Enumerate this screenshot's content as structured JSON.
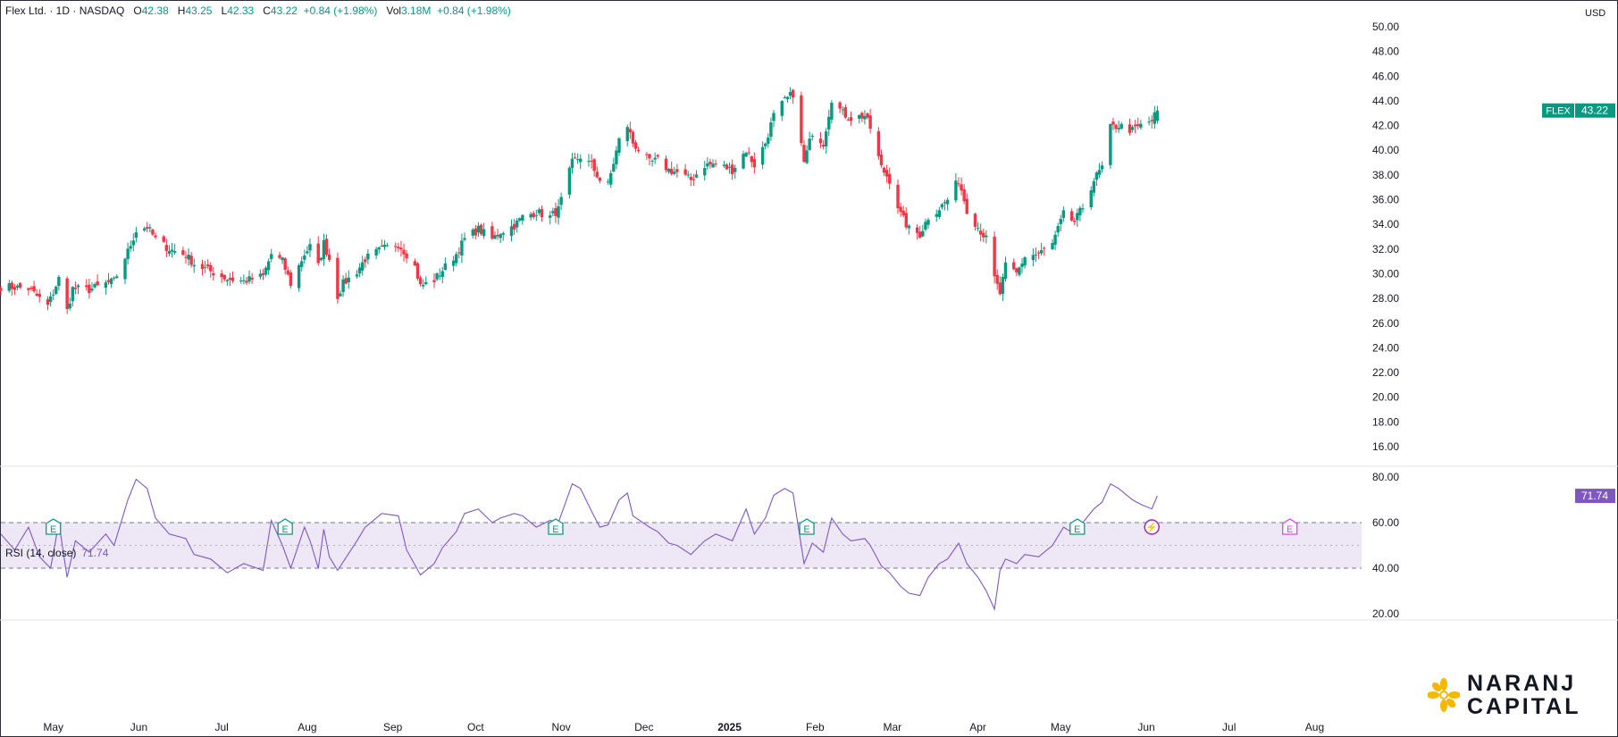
{
  "header": {
    "symbol_title": "Flex Ltd. · 1D · NASDAQ",
    "open_label": "O",
    "open": "42.38",
    "high_label": "H",
    "high": "43.25",
    "low_label": "L",
    "low": "42.33",
    "close_label": "C",
    "close": "43.22",
    "change": "+0.84 (+1.98%)",
    "vol_label": "Vol",
    "vol": "3.18M",
    "vol_change": "+0.84 (+1.98%)"
  },
  "currency": "USD",
  "price_tag": {
    "ticker": "FLEX",
    "value": "43.22"
  },
  "rsi": {
    "label": "RSI (14, close)",
    "value": "71.74",
    "tag": "71.74"
  },
  "logo": {
    "line1": "NARANJ",
    "line2": "CAPITAL"
  },
  "colors": {
    "up": "#089981",
    "down": "#f23645",
    "rsi": "#7e57c2",
    "band": "#ede7f6",
    "earnings": "#089981",
    "dividend": "#9c27b0",
    "upcoming": "#e040fb"
  },
  "events": [
    {
      "type": "earnings",
      "glyph": "E",
      "date": "2024-05-01"
    },
    {
      "type": "earnings",
      "glyph": "E",
      "date": "2024-07-24"
    },
    {
      "type": "earnings",
      "glyph": "E",
      "date": "2024-10-30"
    },
    {
      "type": "earnings",
      "glyph": "E",
      "date": "2025-01-29"
    },
    {
      "type": "earnings",
      "glyph": "E",
      "date": "2025-05-07"
    },
    {
      "type": "split",
      "glyph": "⚡",
      "date": "2025-06-03"
    },
    {
      "type": "earnings-upcoming",
      "glyph": "E",
      "date": "2025-07-23"
    }
  ],
  "chart_data": [
    {
      "type": "candlestick",
      "title": "Flex Ltd. · 1D · NASDAQ",
      "x_axis": {
        "type": "date",
        "range": [
          "2024-04-12",
          "2025-08-18"
        ],
        "ticks": [
          {
            "label": "May",
            "date": "2024-05-01",
            "bold": false
          },
          {
            "label": "Jun",
            "date": "2024-06-01",
            "bold": false
          },
          {
            "label": "Jul",
            "date": "2024-07-01",
            "bold": false
          },
          {
            "label": "Aug",
            "date": "2024-08-01",
            "bold": false
          },
          {
            "label": "Sep",
            "date": "2024-09-01",
            "bold": false
          },
          {
            "label": "Oct",
            "date": "2024-10-01",
            "bold": false
          },
          {
            "label": "Nov",
            "date": "2024-11-01",
            "bold": false
          },
          {
            "label": "Dec",
            "date": "2024-12-01",
            "bold": false
          },
          {
            "label": "2025",
            "date": "2025-01-01",
            "bold": true
          },
          {
            "label": "Feb",
            "date": "2025-02-01",
            "bold": false
          },
          {
            "label": "Mar",
            "date": "2025-03-01",
            "bold": false
          },
          {
            "label": "Apr",
            "date": "2025-04-01",
            "bold": false
          },
          {
            "label": "May",
            "date": "2025-05-01",
            "bold": false
          },
          {
            "label": "Jun",
            "date": "2025-06-01",
            "bold": false
          },
          {
            "label": "Jul",
            "date": "2025-07-01",
            "bold": false
          },
          {
            "label": "Aug",
            "date": "2025-08-01",
            "bold": false
          }
        ]
      },
      "y_axis": {
        "range": [
          14.6,
          51.6
        ],
        "ticks": [
          "16.00",
          "18.00",
          "20.00",
          "22.00",
          "24.00",
          "26.00",
          "28.00",
          "30.00",
          "32.00",
          "34.00",
          "36.00",
          "38.00",
          "40.00",
          "42.00",
          "44.00",
          "46.00",
          "48.00",
          "50.00"
        ]
      },
      "close_series": [
        [
          "2024-04-12",
          29.0
        ],
        [
          "2024-04-22",
          28.8
        ],
        [
          "2024-04-29",
          27.4
        ],
        [
          "2024-05-03",
          29.6
        ],
        [
          "2024-05-06",
          27.0
        ],
        [
          "2024-05-08",
          28.8
        ],
        [
          "2024-05-14",
          28.7
        ],
        [
          "2024-05-20",
          29.2
        ],
        [
          "2024-05-23",
          29.4
        ],
        [
          "2024-05-28",
          31.8
        ],
        [
          "2024-05-31",
          33.5
        ],
        [
          "2024-06-04",
          33.8
        ],
        [
          "2024-06-07",
          32.8
        ],
        [
          "2024-06-12",
          32.0
        ],
        [
          "2024-06-18",
          31.5
        ],
        [
          "2024-06-21",
          30.8
        ],
        [
          "2024-06-27",
          30.2
        ],
        [
          "2024-07-03",
          29.6
        ],
        [
          "2024-07-09",
          29.4
        ],
        [
          "2024-07-16",
          29.8
        ],
        [
          "2024-07-19",
          31.6
        ],
        [
          "2024-07-23",
          31.0
        ],
        [
          "2024-07-26",
          29.2
        ],
        [
          "2024-07-31",
          31.6
        ],
        [
          "2024-08-02",
          32.2
        ],
        [
          "2024-08-05",
          30.6
        ],
        [
          "2024-08-07",
          32.5
        ],
        [
          "2024-08-09",
          31.2
        ],
        [
          "2024-08-12",
          28.2
        ],
        [
          "2024-08-14",
          29.2
        ],
        [
          "2024-08-19",
          30.2
        ],
        [
          "2024-08-22",
          31.2
        ],
        [
          "2024-08-28",
          32.0
        ],
        [
          "2024-09-03",
          32.4
        ],
        [
          "2024-09-06",
          31.6
        ],
        [
          "2024-09-09",
          30.6
        ],
        [
          "2024-09-11",
          29.0
        ],
        [
          "2024-09-16",
          29.5
        ],
        [
          "2024-09-19",
          30.3
        ],
        [
          "2024-09-24",
          31.6
        ],
        [
          "2024-09-27",
          32.8
        ],
        [
          "2024-10-02",
          33.6
        ],
        [
          "2024-10-07",
          32.8
        ],
        [
          "2024-10-10",
          33.4
        ],
        [
          "2024-10-15",
          33.9
        ],
        [
          "2024-10-18",
          34.6
        ],
        [
          "2024-10-23",
          35.0
        ],
        [
          "2024-10-28",
          34.6
        ],
        [
          "2024-10-31",
          35.2
        ],
        [
          "2024-11-05",
          39.0
        ],
        [
          "2024-11-08",
          39.5
        ],
        [
          "2024-11-12",
          38.8
        ],
        [
          "2024-11-15",
          37.6
        ],
        [
          "2024-11-18",
          37.2
        ],
        [
          "2024-11-22",
          40.8
        ],
        [
          "2024-11-25",
          42.0
        ],
        [
          "2024-11-27",
          40.6
        ],
        [
          "2024-12-03",
          39.0
        ],
        [
          "2024-12-06",
          39.2
        ],
        [
          "2024-12-10",
          38.4
        ],
        [
          "2024-12-13",
          38.2
        ],
        [
          "2024-12-18",
          37.6
        ],
        [
          "2024-12-23",
          38.8
        ],
        [
          "2024-12-27",
          38.9
        ],
        [
          "2025-01-02",
          38.4
        ],
        [
          "2025-01-07",
          40.0
        ],
        [
          "2025-01-10",
          38.8
        ],
        [
          "2025-01-14",
          40.6
        ],
        [
          "2025-01-17",
          42.8
        ],
        [
          "2025-01-21",
          44.0
        ],
        [
          "2025-01-24",
          44.6
        ],
        [
          "2025-01-28",
          39.0
        ],
        [
          "2025-01-31",
          41.5
        ],
        [
          "2025-02-04",
          40.6
        ],
        [
          "2025-02-07",
          44.2
        ],
        [
          "2025-02-11",
          43.0
        ],
        [
          "2025-02-14",
          42.6
        ],
        [
          "2025-02-19",
          42.8
        ],
        [
          "2025-02-21",
          41.8
        ],
        [
          "2025-02-25",
          38.6
        ],
        [
          "2025-02-28",
          37.6
        ],
        [
          "2025-03-04",
          34.8
        ],
        [
          "2025-03-07",
          33.6
        ],
        [
          "2025-03-11",
          33.2
        ],
        [
          "2025-03-14",
          34.6
        ],
        [
          "2025-03-18",
          35.3
        ],
        [
          "2025-03-21",
          36.0
        ],
        [
          "2025-03-25",
          37.6
        ],
        [
          "2025-03-28",
          35.2
        ],
        [
          "2025-04-01",
          33.8
        ],
        [
          "2025-04-04",
          32.8
        ],
        [
          "2025-04-07",
          29.6
        ],
        [
          "2025-04-09",
          28.4
        ],
        [
          "2025-04-11",
          30.6
        ],
        [
          "2025-04-15",
          30.0
        ],
        [
          "2025-04-18",
          31.4
        ],
        [
          "2025-04-23",
          31.6
        ],
        [
          "2025-04-28",
          32.4
        ],
        [
          "2025-05-02",
          34.8
        ],
        [
          "2025-05-06",
          34.2
        ],
        [
          "2025-05-09",
          35.4
        ],
        [
          "2025-05-13",
          37.6
        ],
        [
          "2025-05-16",
          38.6
        ],
        [
          "2025-05-19",
          41.8
        ],
        [
          "2025-05-22",
          42.0
        ],
        [
          "2025-05-27",
          41.6
        ],
        [
          "2025-05-30",
          42.0
        ],
        [
          "2025-06-03",
          42.4
        ],
        [
          "2025-06-05",
          43.22
        ]
      ]
    },
    {
      "type": "line",
      "title": "RSI (14, close)",
      "y_axis": {
        "range": [
          16.5,
          83.5
        ],
        "ticks": [
          "20.00",
          "40.00",
          "60.00",
          "80.00"
        ],
        "band": [
          40,
          60
        ],
        "midline": 50
      },
      "series": [
        [
          "2024-04-12",
          55
        ],
        [
          "2024-04-17",
          48
        ],
        [
          "2024-04-22",
          58
        ],
        [
          "2024-04-26",
          45
        ],
        [
          "2024-04-30",
          40
        ],
        [
          "2024-05-03",
          60
        ],
        [
          "2024-05-06",
          36
        ],
        [
          "2024-05-09",
          52
        ],
        [
          "2024-05-14",
          47
        ],
        [
          "2024-05-20",
          55
        ],
        [
          "2024-05-23",
          50
        ],
        [
          "2024-05-28",
          70
        ],
        [
          "2024-05-31",
          79
        ],
        [
          "2024-06-04",
          75
        ],
        [
          "2024-06-07",
          62
        ],
        [
          "2024-06-12",
          55
        ],
        [
          "2024-06-18",
          53
        ],
        [
          "2024-06-21",
          46
        ],
        [
          "2024-06-27",
          44
        ],
        [
          "2024-07-03",
          38
        ],
        [
          "2024-07-09",
          42
        ],
        [
          "2024-07-16",
          39
        ],
        [
          "2024-07-19",
          61
        ],
        [
          "2024-07-23",
          50
        ],
        [
          "2024-07-26",
          40
        ],
        [
          "2024-07-31",
          58
        ],
        [
          "2024-08-02",
          52
        ],
        [
          "2024-08-05",
          40
        ],
        [
          "2024-08-07",
          57
        ],
        [
          "2024-08-09",
          45
        ],
        [
          "2024-08-12",
          39
        ],
        [
          "2024-08-19",
          52
        ],
        [
          "2024-08-22",
          58
        ],
        [
          "2024-08-28",
          64
        ],
        [
          "2024-09-03",
          63
        ],
        [
          "2024-09-06",
          48
        ],
        [
          "2024-09-11",
          37
        ],
        [
          "2024-09-16",
          42
        ],
        [
          "2024-09-19",
          49
        ],
        [
          "2024-09-24",
          56
        ],
        [
          "2024-09-27",
          64
        ],
        [
          "2024-10-02",
          66
        ],
        [
          "2024-10-07",
          60
        ],
        [
          "2024-10-10",
          62
        ],
        [
          "2024-10-15",
          64
        ],
        [
          "2024-10-18",
          63
        ],
        [
          "2024-10-23",
          58
        ],
        [
          "2024-10-28",
          61
        ],
        [
          "2024-10-31",
          60
        ],
        [
          "2024-11-05",
          77
        ],
        [
          "2024-11-08",
          75
        ],
        [
          "2024-11-12",
          65
        ],
        [
          "2024-11-15",
          58
        ],
        [
          "2024-11-18",
          59
        ],
        [
          "2024-11-22",
          70
        ],
        [
          "2024-11-25",
          73
        ],
        [
          "2024-11-27",
          63
        ],
        [
          "2024-12-03",
          58
        ],
        [
          "2024-12-06",
          56
        ],
        [
          "2024-12-10",
          51
        ],
        [
          "2024-12-13",
          50
        ],
        [
          "2024-12-18",
          46
        ],
        [
          "2024-12-23",
          52
        ],
        [
          "2024-12-27",
          55
        ],
        [
          "2025-01-02",
          52
        ],
        [
          "2025-01-07",
          66
        ],
        [
          "2025-01-10",
          55
        ],
        [
          "2025-01-14",
          62
        ],
        [
          "2025-01-17",
          72
        ],
        [
          "2025-01-21",
          75
        ],
        [
          "2025-01-24",
          73
        ],
        [
          "2025-01-28",
          42
        ],
        [
          "2025-01-31",
          51
        ],
        [
          "2025-02-04",
          47
        ],
        [
          "2025-02-07",
          62
        ],
        [
          "2025-02-11",
          55
        ],
        [
          "2025-02-14",
          52
        ],
        [
          "2025-02-19",
          53
        ],
        [
          "2025-02-21",
          50
        ],
        [
          "2025-02-25",
          41
        ],
        [
          "2025-02-28",
          38
        ],
        [
          "2025-03-04",
          32
        ],
        [
          "2025-03-07",
          29
        ],
        [
          "2025-03-11",
          28
        ],
        [
          "2025-03-14",
          36
        ],
        [
          "2025-03-18",
          42
        ],
        [
          "2025-03-21",
          44
        ],
        [
          "2025-03-25",
          51
        ],
        [
          "2025-03-28",
          42
        ],
        [
          "2025-04-01",
          36
        ],
        [
          "2025-04-04",
          30
        ],
        [
          "2025-04-07",
          22
        ],
        [
          "2025-04-09",
          39
        ],
        [
          "2025-04-11",
          44
        ],
        [
          "2025-04-15",
          42
        ],
        [
          "2025-04-18",
          46
        ],
        [
          "2025-04-23",
          45
        ],
        [
          "2025-04-28",
          50
        ],
        [
          "2025-05-02",
          58
        ],
        [
          "2025-05-06",
          55
        ],
        [
          "2025-05-09",
          60
        ],
        [
          "2025-05-13",
          66
        ],
        [
          "2025-05-16",
          69
        ],
        [
          "2025-05-19",
          77
        ],
        [
          "2025-05-22",
          75
        ],
        [
          "2025-05-27",
          70
        ],
        [
          "2025-05-30",
          68
        ],
        [
          "2025-06-03",
          66
        ],
        [
          "2025-06-05",
          71.74
        ]
      ]
    }
  ]
}
